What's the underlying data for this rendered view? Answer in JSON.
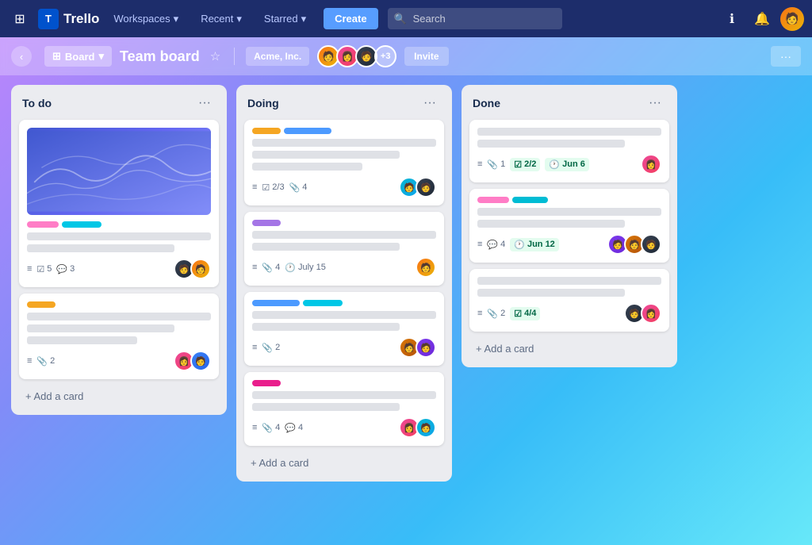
{
  "nav": {
    "logo": "T",
    "app_name": "Trello",
    "workspaces": "Workspaces",
    "recent": "Recent",
    "starred": "Starred",
    "create": "Create",
    "search_placeholder": "Search",
    "info_icon": "ℹ",
    "bell_icon": "🔔"
  },
  "board_header": {
    "view": "Board",
    "title": "Team board",
    "workspace": "Acme, Inc.",
    "extra_members": "+3",
    "invite": "Invite",
    "more": "···"
  },
  "columns": [
    {
      "title": "To do",
      "cards": [
        {
          "has_image": true,
          "labels": [
            "pink",
            "cyan"
          ],
          "lines": [
            "full",
            "medium"
          ],
          "meta": {
            "checklist": "5",
            "comment": "3"
          },
          "avatars": [
            "dark",
            "orange"
          ]
        },
        {
          "has_image": false,
          "labels": [],
          "lines": [
            "full",
            "short"
          ],
          "meta": {
            "attach": "2"
          },
          "avatars": [
            "pink",
            "blue"
          ]
        }
      ],
      "add_label": "+ Add a card"
    },
    {
      "title": "Doing",
      "cards": [
        {
          "has_image": false,
          "labels": [
            "yellow",
            "blue"
          ],
          "lines": [
            "full",
            "medium",
            "short"
          ],
          "meta": {
            "checklist": "2/3",
            "attach": "4"
          },
          "avatars": [
            "teal",
            "dark"
          ]
        },
        {
          "has_image": false,
          "labels": [
            "purple"
          ],
          "lines": [
            "full",
            "medium"
          ],
          "meta": {
            "attach": "4",
            "date": "July 15"
          },
          "avatars": [
            "orange"
          ]
        },
        {
          "has_image": false,
          "labels": [
            "blue",
            "cyan"
          ],
          "lines": [
            "full",
            "medium"
          ],
          "meta": {
            "attach": "2"
          },
          "avatars": [
            "gold",
            "purple"
          ]
        },
        {
          "has_image": false,
          "labels": [
            "magenta"
          ],
          "lines": [
            "full",
            "medium"
          ],
          "meta": {
            "attach": "4",
            "comment": "4"
          },
          "avatars": [
            "pink",
            "teal"
          ]
        }
      ],
      "add_label": "+ Add a card"
    },
    {
      "title": "Done",
      "cards": [
        {
          "has_image": false,
          "labels": [],
          "lines": [
            "full",
            "medium"
          ],
          "meta": {
            "attach": "1",
            "checklist_badge": "2/2",
            "date_badge": "Jun 6"
          },
          "avatars": [
            "pink"
          ]
        },
        {
          "has_image": false,
          "labels": [
            "pink",
            "teal"
          ],
          "lines": [
            "full",
            "medium"
          ],
          "meta": {
            "comment": "4",
            "date_badge": "Jun 12"
          },
          "avatars": [
            "purple",
            "gold",
            "dark"
          ]
        },
        {
          "has_image": false,
          "labels": [],
          "lines": [
            "full",
            "medium"
          ],
          "meta": {
            "attach": "2",
            "checklist_badge": "4/4"
          },
          "avatars": [
            "dark",
            "pink"
          ]
        }
      ],
      "add_label": "+ Add a card"
    }
  ]
}
